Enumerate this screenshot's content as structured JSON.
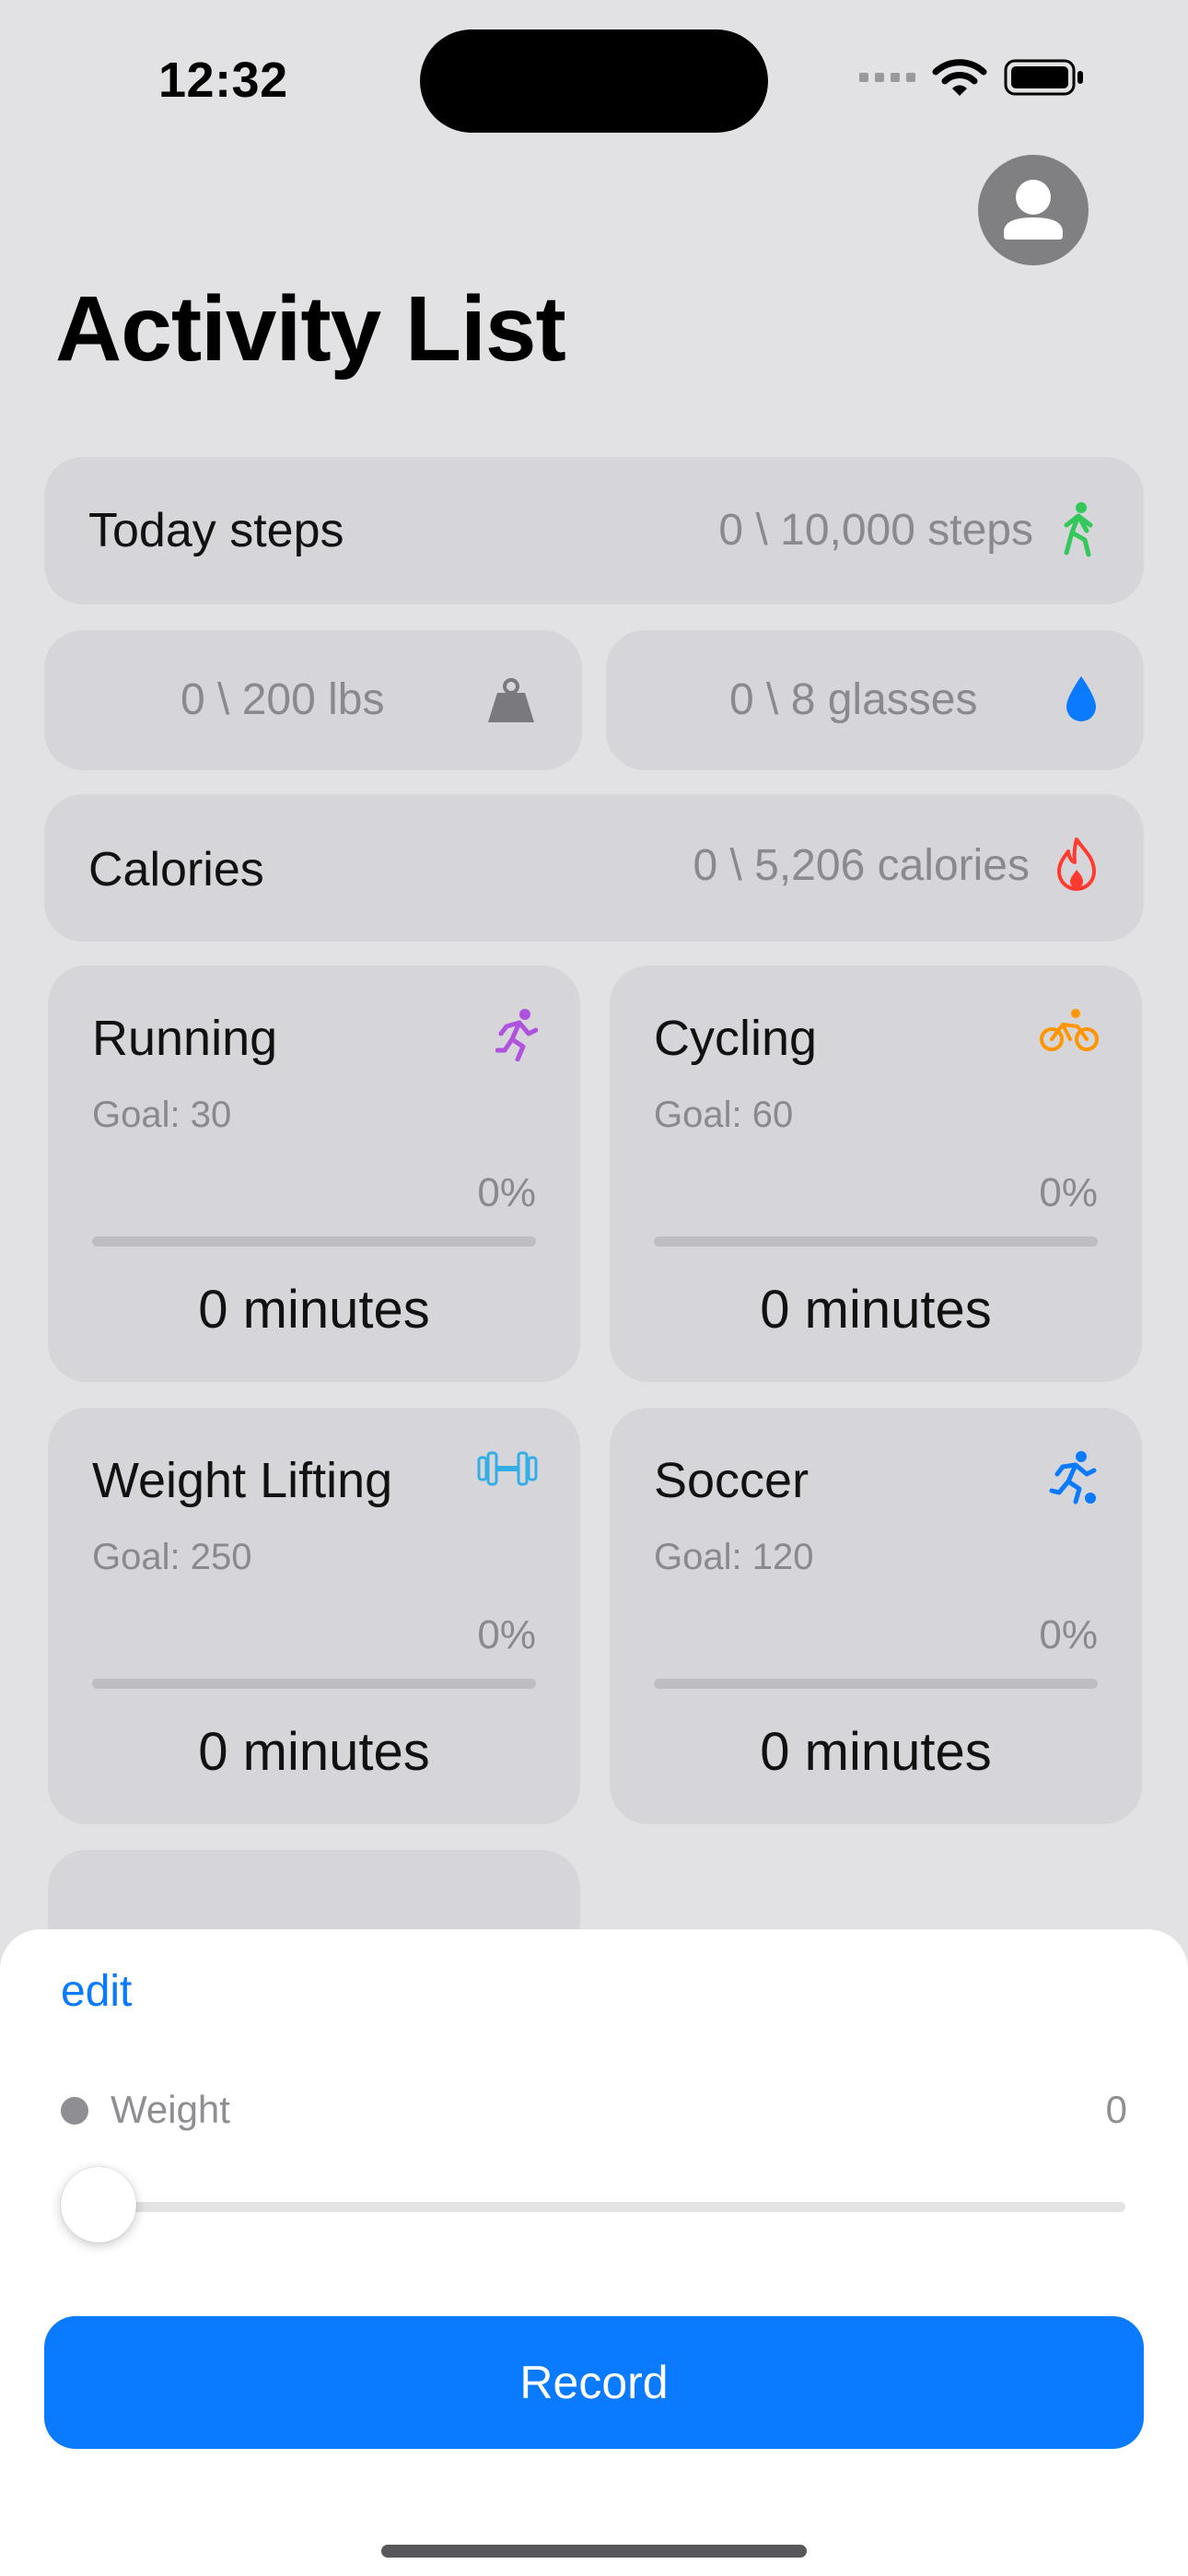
{
  "status_bar": {
    "time": "12:32"
  },
  "header": {
    "title": "Activity List"
  },
  "steps": {
    "label": "Today steps",
    "value": "0 \\ 10,000 steps",
    "icon": "walking-figure-icon",
    "icon_color": "#34c759"
  },
  "weight": {
    "value": "0 \\ 200 lbs",
    "icon": "scale-weight-icon"
  },
  "water": {
    "value": "0 \\ 8 glasses",
    "icon": "water-drop-icon",
    "icon_color": "#0a7aff"
  },
  "calories": {
    "label": "Calories",
    "value": "0 \\ 5,206 calories",
    "icon": "flame-icon",
    "icon_color": "#ff3b30"
  },
  "activities": [
    {
      "name": "Running",
      "goal": "Goal: 30",
      "percent": "0%",
      "progress": 0,
      "minutes": "0 minutes",
      "icon": "running-figure-icon",
      "icon_color": "#af52de"
    },
    {
      "name": "Cycling",
      "goal": "Goal: 60",
      "percent": "0%",
      "progress": 0,
      "minutes": "0 minutes",
      "icon": "bicycle-icon",
      "icon_color": "#ff9500"
    },
    {
      "name": "Weight Lifting",
      "goal": "Goal: 250",
      "percent": "0%",
      "progress": 0,
      "minutes": "0 minutes",
      "icon": "dumbbell-icon",
      "icon_color": "#32ade6"
    },
    {
      "name": "Soccer",
      "goal": "Goal: 120",
      "percent": "0%",
      "progress": 0,
      "minutes": "0 minutes",
      "icon": "soccer-player-icon",
      "icon_color": "#0a7aff"
    }
  ],
  "sheet": {
    "edit_label": "edit",
    "metric_label": "Weight",
    "metric_value": "0",
    "slider_value": 0,
    "record_label": "Record",
    "accent": "#0a7aff"
  }
}
